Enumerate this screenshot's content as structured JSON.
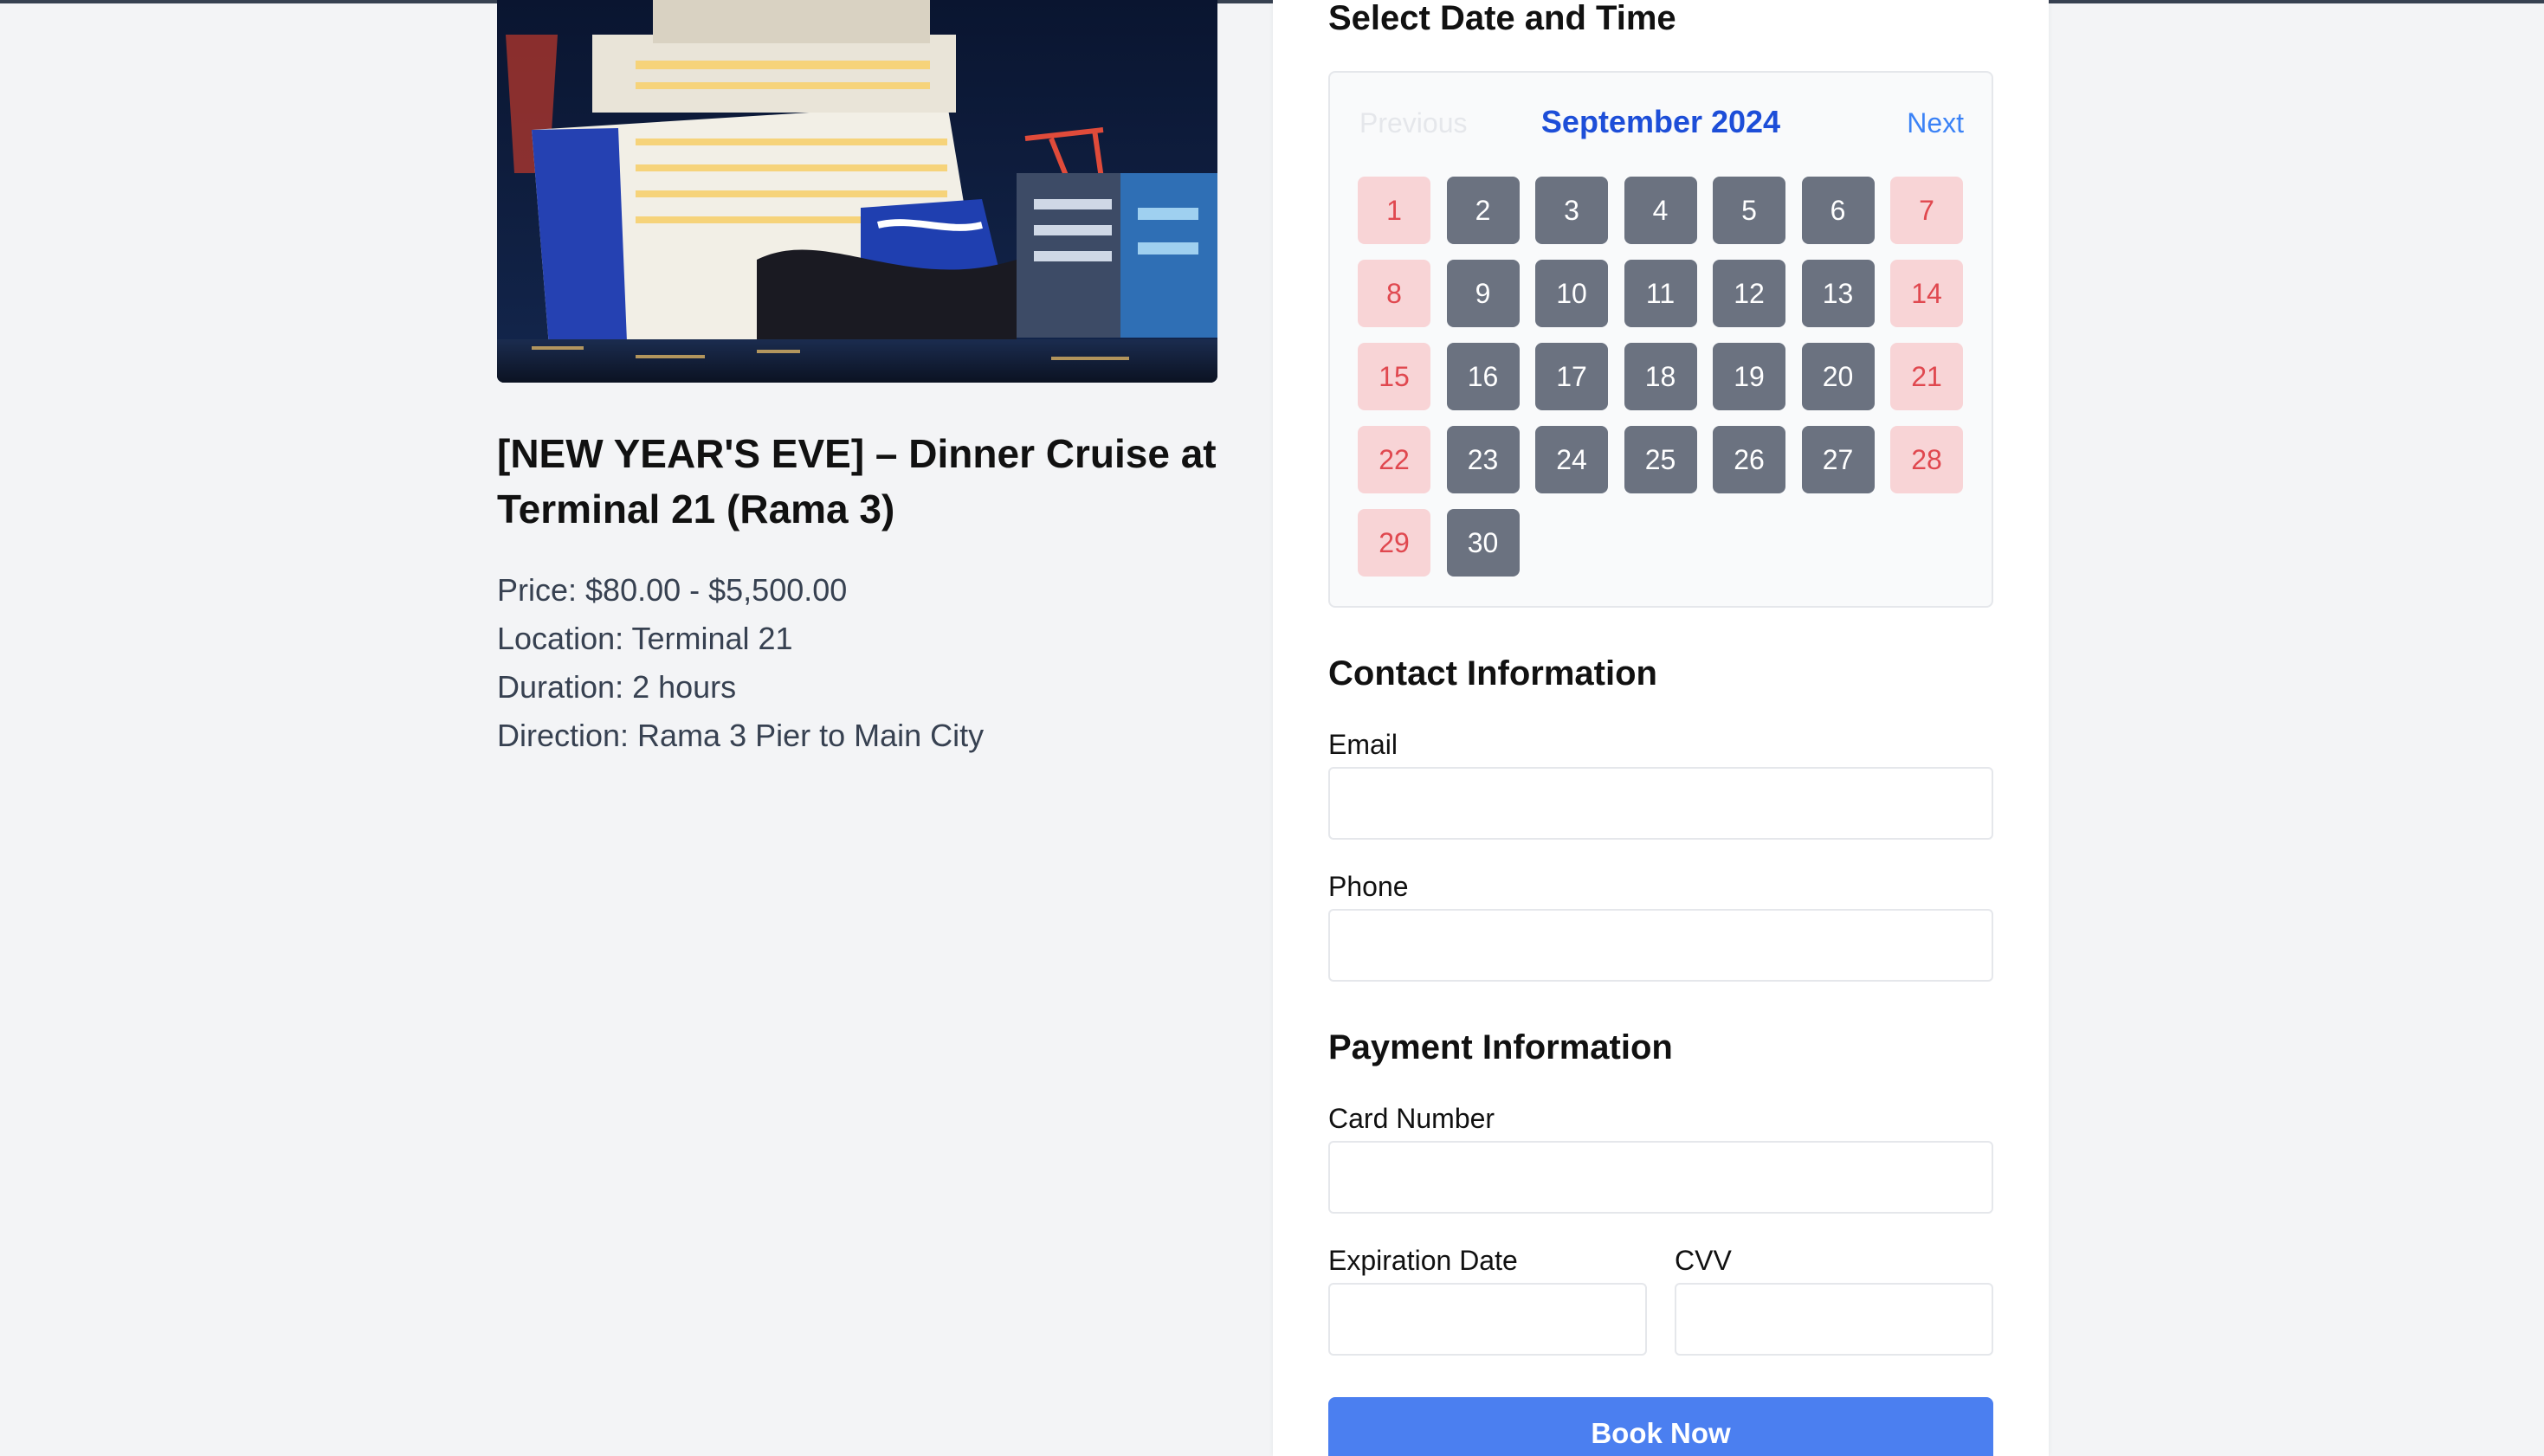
{
  "event": {
    "title": "[NEW YEAR'S EVE] – Dinner Cruise at Terminal 21 (Rama 3)",
    "price": "Price: $80.00 - $5,500.00",
    "location": "Location: Terminal 21",
    "duration": "Duration: 2 hours",
    "direction": "Direction: Rama 3 Pier to Main City"
  },
  "booking": {
    "date_heading": "Select Date and Time",
    "calendar": {
      "previous_label": "Previous",
      "month_label": "September 2024",
      "next_label": "Next",
      "days": [
        {
          "n": "1",
          "weekend": true
        },
        {
          "n": "2",
          "weekend": false
        },
        {
          "n": "3",
          "weekend": false
        },
        {
          "n": "4",
          "weekend": false
        },
        {
          "n": "5",
          "weekend": false
        },
        {
          "n": "6",
          "weekend": false
        },
        {
          "n": "7",
          "weekend": true
        },
        {
          "n": "8",
          "weekend": true
        },
        {
          "n": "9",
          "weekend": false
        },
        {
          "n": "10",
          "weekend": false
        },
        {
          "n": "11",
          "weekend": false
        },
        {
          "n": "12",
          "weekend": false
        },
        {
          "n": "13",
          "weekend": false
        },
        {
          "n": "14",
          "weekend": true
        },
        {
          "n": "15",
          "weekend": true
        },
        {
          "n": "16",
          "weekend": false
        },
        {
          "n": "17",
          "weekend": false
        },
        {
          "n": "18",
          "weekend": false
        },
        {
          "n": "19",
          "weekend": false
        },
        {
          "n": "20",
          "weekend": false
        },
        {
          "n": "21",
          "weekend": true
        },
        {
          "n": "22",
          "weekend": true
        },
        {
          "n": "23",
          "weekend": false
        },
        {
          "n": "24",
          "weekend": false
        },
        {
          "n": "25",
          "weekend": false
        },
        {
          "n": "26",
          "weekend": false
        },
        {
          "n": "27",
          "weekend": false
        },
        {
          "n": "28",
          "weekend": true
        },
        {
          "n": "29",
          "weekend": true
        },
        {
          "n": "30",
          "weekend": false
        }
      ]
    },
    "contact_heading": "Contact Information",
    "email_label": "Email",
    "email_value": "",
    "phone_label": "Phone",
    "phone_value": "",
    "payment_heading": "Payment Information",
    "card_label": "Card Number",
    "card_value": "",
    "expiration_label": "Expiration Date",
    "expiration_value": "",
    "cvv_label": "CVV",
    "cvv_value": "",
    "submit_label": "Book Now"
  },
  "colors": {
    "background": "#f3f4f6",
    "month_label": "#1d4ed8",
    "next_link": "#3b82f6",
    "weekday_cell": "#6b7280",
    "weekend_cell": "#f8d4d6",
    "weekend_text": "#e0484f",
    "submit_button": "#4b7ff0"
  },
  "icons": {
    "hero_image": "cruise-ship-at-night-photo"
  }
}
